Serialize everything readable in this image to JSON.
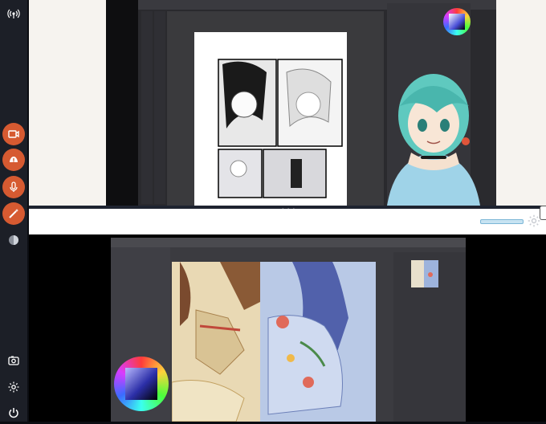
{
  "sidebar": {
    "items": [
      {
        "icon": "antenna-icon",
        "label": ""
      },
      {
        "icon": "camera-video-icon",
        "label": ""
      },
      {
        "icon": "alert-icon",
        "label": ""
      },
      {
        "icon": "microphone-icon",
        "label": ""
      },
      {
        "icon": "wand-icon",
        "label": ""
      },
      {
        "icon": "globe-icon",
        "label": ""
      },
      {
        "icon": "screenshot-icon",
        "label": ""
      },
      {
        "icon": "gear-icon",
        "label": ""
      },
      {
        "icon": "power-icon",
        "label": ""
      }
    ]
  },
  "top_stream": {
    "pager": "•••"
  },
  "colors": {
    "accent": "#d65a31",
    "sidebar_bg": "#1c1f27",
    "panel_bg": "#f6f3ef"
  }
}
